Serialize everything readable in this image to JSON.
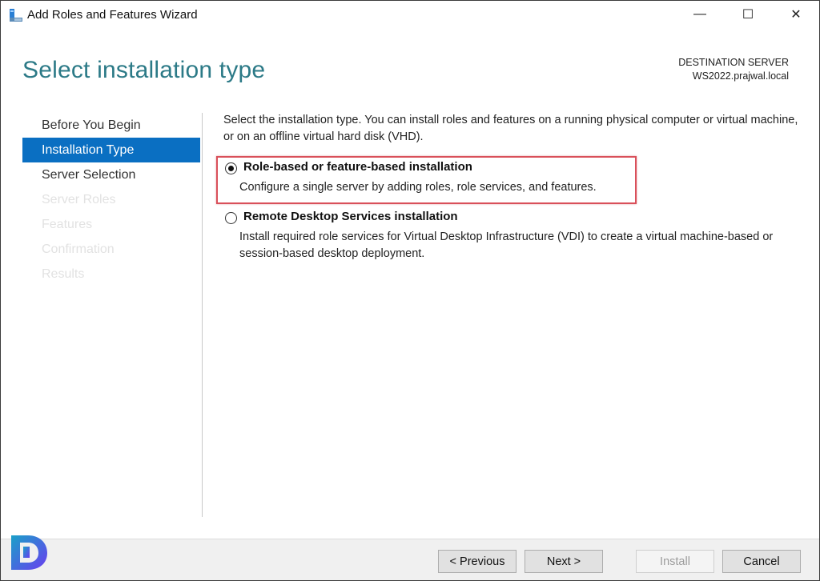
{
  "window": {
    "title": "Add Roles and Features Wizard",
    "controls": {
      "minimize": "—",
      "maximize": "☐",
      "close": "✕"
    }
  },
  "header": {
    "page_title": "Select installation type",
    "destination_label": "DESTINATION SERVER",
    "destination_server": "WS2022.prajwal.local"
  },
  "sidebar": {
    "items": [
      {
        "label": "Before You Begin",
        "state": "enabled"
      },
      {
        "label": "Installation Type",
        "state": "active"
      },
      {
        "label": "Server Selection",
        "state": "enabled"
      },
      {
        "label": "Server Roles",
        "state": "disabled"
      },
      {
        "label": "Features",
        "state": "disabled"
      },
      {
        "label": "Confirmation",
        "state": "disabled"
      },
      {
        "label": "Results",
        "state": "disabled"
      }
    ]
  },
  "main": {
    "intro": "Select the installation type. You can install roles and features on a running physical computer or virtual machine, or on an offline virtual hard disk (VHD).",
    "options": [
      {
        "label": "Role-based or feature-based installation",
        "description": "Configure a single server by adding roles, role services, and features.",
        "selected": true
      },
      {
        "label": "Remote Desktop Services installation",
        "description": "Install required role services for Virtual Desktop Infrastructure (VDI) to create a virtual machine-based or session-based desktop deployment.",
        "selected": false
      }
    ]
  },
  "footer": {
    "previous_label": "< Previous",
    "next_label": "Next >",
    "install_label": "Install",
    "cancel_label": "Cancel"
  },
  "colors": {
    "accent": "#0a6fc2",
    "title": "#2c7a87",
    "highlight": "#d9505a"
  }
}
